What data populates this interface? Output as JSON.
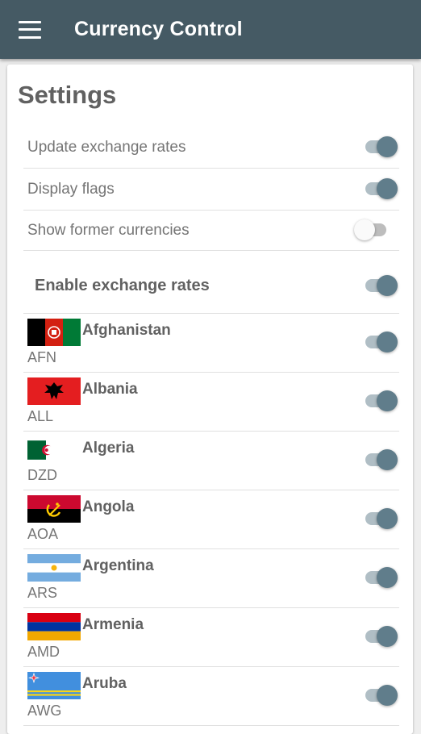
{
  "appbar": {
    "title": "Currency Control",
    "menu_icon": "menu-icon"
  },
  "settings": {
    "heading": "Settings",
    "options": [
      {
        "label": "Update exchange rates",
        "enabled": true
      },
      {
        "label": "Display flags",
        "enabled": true
      },
      {
        "label": "Show former currencies",
        "enabled": false
      }
    ],
    "enable_rates": {
      "label": "Enable exchange rates",
      "enabled": true
    }
  },
  "countries": [
    {
      "name": "Afghanistan",
      "code": "AFN",
      "enabled": true
    },
    {
      "name": "Albania",
      "code": "ALL",
      "enabled": true
    },
    {
      "name": "Algeria",
      "code": "DZD",
      "enabled": true
    },
    {
      "name": "Angola",
      "code": "AOA",
      "enabled": true
    },
    {
      "name": "Argentina",
      "code": "ARS",
      "enabled": true
    },
    {
      "name": "Armenia",
      "code": "AMD",
      "enabled": true
    },
    {
      "name": "Aruba",
      "code": "AWG",
      "enabled": true
    }
  ],
  "colors": {
    "appbar": "#455a64",
    "switch_on": "#607d8b",
    "switch_track_on": "#b0bec5"
  }
}
